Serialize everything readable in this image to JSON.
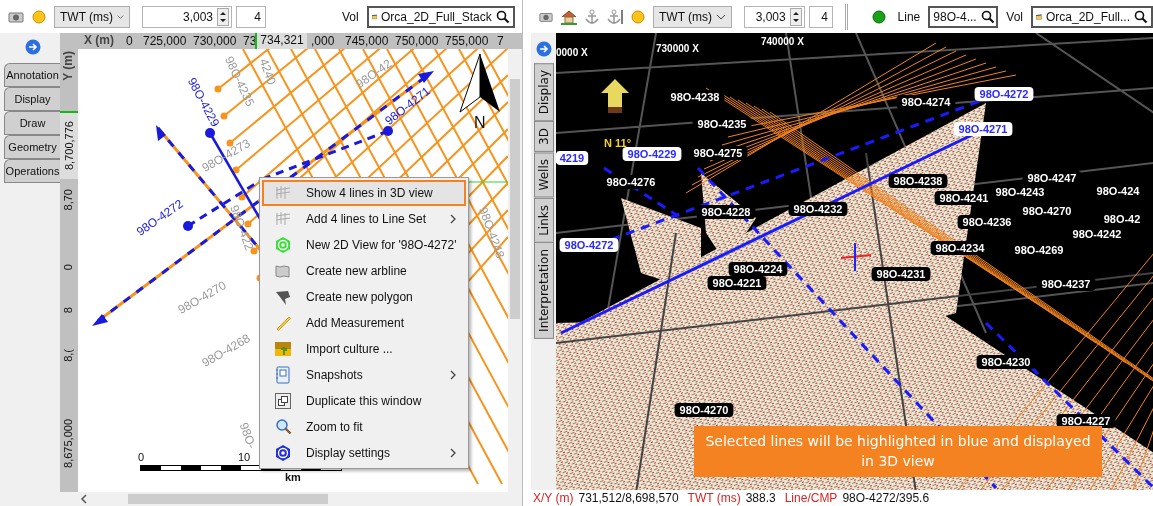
{
  "left_view": {
    "toolbar": {
      "domain": "TWT (ms)",
      "value": "3,003",
      "step": "4",
      "vol_label": "Vol",
      "volume": "Orca_2D_Full_Stack"
    },
    "tabs": [
      {
        "label": "Annotation",
        "selected": false
      },
      {
        "label": "Display",
        "selected": false
      },
      {
        "label": "Draw",
        "selected": false
      },
      {
        "label": "Geometry",
        "selected": false
      },
      {
        "label": "Operations",
        "selected": false
      }
    ],
    "x_ruler": {
      "title": "X (m)",
      "ticks": [
        "0",
        "725,000",
        "730,000",
        "73",
        ",000",
        "745,000",
        "750,000",
        "755,000",
        "7"
      ],
      "cursor": "734,321"
    },
    "y_ruler": {
      "title": "Y (m)",
      "ticks": [
        "8,70",
        "0",
        "8",
        "8,(",
        "8,675,000"
      ],
      "cursor": "8,700,776"
    },
    "map_labels": [
      {
        "text": "98O-4229",
        "selected": true
      },
      {
        "text": "98O-4271",
        "selected": true
      },
      {
        "text": "98O-4272",
        "selected": true
      },
      {
        "text": "98O-4273",
        "selected": false
      },
      {
        "text": "98O-4235",
        "selected": false
      },
      {
        "text": "4240",
        "selected": false
      },
      {
        "text": "98O-42",
        "selected": false
      },
      {
        "text": "98O-422",
        "selected": false
      },
      {
        "text": "98O-4270",
        "selected": false
      },
      {
        "text": "98O-4268",
        "selected": false
      },
      {
        "text": "98O-",
        "selected": false
      },
      {
        "text": "98O-4248",
        "selected": false
      }
    ],
    "north_label": "N",
    "scale_bar": {
      "ticks": [
        "0",
        "10"
      ],
      "unit": "km"
    },
    "context_menu": [
      {
        "label": "Show 4 lines in 3D view",
        "highlighted": true,
        "submenu": false
      },
      {
        "label": "Add 4 lines to Line Set",
        "highlighted": false,
        "submenu": true
      },
      {
        "label": "New 2D View for '98O-4272'",
        "highlighted": false,
        "submenu": false
      },
      {
        "label": "Create new arbline",
        "highlighted": false,
        "submenu": false
      },
      {
        "label": "Create new polygon",
        "highlighted": false,
        "submenu": false
      },
      {
        "label": "Add Measurement",
        "highlighted": false,
        "submenu": false
      },
      {
        "label": "Import culture ...",
        "highlighted": false,
        "submenu": false
      },
      {
        "label": "Snapshots",
        "highlighted": false,
        "submenu": true
      },
      {
        "label": "Duplicate this window",
        "highlighted": false,
        "submenu": false
      },
      {
        "label": "Zoom to fit",
        "highlighted": false,
        "submenu": false
      },
      {
        "label": "Display settings",
        "highlighted": false,
        "submenu": true
      }
    ]
  },
  "right_view": {
    "toolbar": {
      "domain": "TWT (ms)",
      "value": "3,003",
      "step": "4",
      "line_label": "Line",
      "line": "98O-4...",
      "vol_label": "Vol",
      "volume": "Orca_2D_Full..."
    },
    "tabs": [
      {
        "label": "Display",
        "selected": false
      },
      {
        "label": "3D",
        "selected": false
      },
      {
        "label": "Wells",
        "selected": false
      },
      {
        "label": "Links",
        "selected": false
      },
      {
        "label": "Interpretation",
        "selected": false
      }
    ],
    "axis_labels": [
      "0000 X",
      "730000 X",
      "740000 X"
    ],
    "compass": "N 11°",
    "line_labels": [
      {
        "text": "98O-4238",
        "selected": false
      },
      {
        "text": "98O-4274",
        "selected": false
      },
      {
        "text": "98O-4272",
        "selected": true
      },
      {
        "text": "98O-4235",
        "selected": false
      },
      {
        "text": "98O-4271",
        "selected": true
      },
      {
        "text": "4219",
        "selected": true
      },
      {
        "text": "98O-4229",
        "selected": true
      },
      {
        "text": "98O-4275",
        "selected": false
      },
      {
        "text": "98O-4276",
        "selected": false
      },
      {
        "text": "98O-4238",
        "selected": false
      },
      {
        "text": "98O-4247",
        "selected": false
      },
      {
        "text": "98O-424",
        "selected": false
      },
      {
        "text": "98O-4243",
        "selected": false
      },
      {
        "text": "98O-4241",
        "selected": false
      },
      {
        "text": "98O-4228",
        "selected": false
      },
      {
        "text": "98O-4232",
        "selected": false
      },
      {
        "text": "98O-4270",
        "selected": false
      },
      {
        "text": "98O-42",
        "selected": false
      },
      {
        "text": "98O-4236",
        "selected": false
      },
      {
        "text": "98O-4242",
        "selected": false
      },
      {
        "text": "98O-4272",
        "selected": true
      },
      {
        "text": "98O-4234",
        "selected": false
      },
      {
        "text": "98O-4269",
        "selected": false
      },
      {
        "text": "98O-4224",
        "selected": false
      },
      {
        "text": "98O-4231",
        "selected": false
      },
      {
        "text": "98O-4221",
        "selected": false
      },
      {
        "text": "98O-4237",
        "selected": false
      },
      {
        "text": "98O-4230",
        "selected": false
      },
      {
        "text": "98O-4270",
        "selected": false
      },
      {
        "text": "98O-4227",
        "selected": false
      }
    ],
    "status_bar": [
      {
        "label": "X/Y (m)",
        "value": "731,512/8,698,570"
      },
      {
        "label": "TWT (ms)",
        "value": "388.3"
      },
      {
        "label": "Line/CMP",
        "value": "98O-4272/395.6"
      }
    ]
  },
  "callout": "Selected lines will be highlighted in blue and displayed in 3D view"
}
